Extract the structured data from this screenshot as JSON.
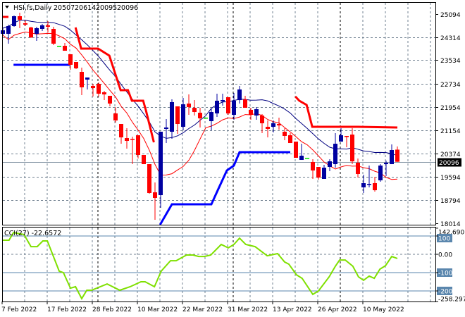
{
  "header": {
    "symbol": "HSI,fs,Daily",
    "open": "20507",
    "high": "20614",
    "low": "20095",
    "close": "20096"
  },
  "colors": {
    "bull": "#0000a0",
    "bear": "#ff0000",
    "doji": "#00e000",
    "stop_upper": "#ff0000",
    "stop_lower": "#0000ff",
    "ma_high": "#000080",
    "ma_low": "#ff0000",
    "cci": "#7fe000",
    "level": "#5a86ad",
    "grid": "#708090"
  },
  "chart_data": [
    {
      "type": "candlestick",
      "title": "HSI,fs,Daily",
      "ylim": [
        18014,
        25094
      ],
      "y_ticks": [
        "25094",
        "24314",
        "23534",
        "22734",
        "21954",
        "21154",
        "20374",
        "19594",
        "18794",
        "18014"
      ],
      "y_tick_values": [
        25094,
        24314,
        23534,
        22734,
        21954,
        21154,
        20374,
        19594,
        18794,
        18014
      ],
      "current_price": 20096,
      "current_price_label": "20096",
      "x_labels": [
        {
          "index": 0,
          "label": "7 Feb 2022"
        },
        {
          "index": 8,
          "label": "17 Feb 2022"
        },
        {
          "index": 16,
          "label": "28 Feb 2022"
        },
        {
          "index": 24,
          "label": "10 Mar 2022"
        },
        {
          "index": 32,
          "label": "22 Mar 2022"
        },
        {
          "index": 40,
          "label": "31 Mar 2022"
        },
        {
          "index": 48,
          "label": "13 Apr 2022"
        },
        {
          "index": 56,
          "label": "26 Apr 2022"
        },
        {
          "index": 64,
          "label": "10 May 2022"
        }
      ],
      "separators": [
        17,
        41,
        60
      ],
      "ohlc": [
        [
          24426,
          24617,
          24379,
          24546
        ],
        [
          24426,
          24736,
          24093,
          24689
        ],
        [
          24689,
          25046,
          24665,
          25022
        ],
        [
          25022,
          25142,
          24617,
          24903
        ],
        [
          24784,
          24879,
          24689,
          24736
        ],
        [
          24641,
          24665,
          24283,
          24307
        ],
        [
          24426,
          24665,
          24188,
          24617
        ],
        [
          24593,
          24760,
          24522,
          24713
        ],
        [
          24713,
          24856,
          24474,
          24665
        ],
        [
          24593,
          24665,
          24045,
          24093
        ],
        [
          24021,
          24021,
          24021,
          24021
        ],
        [
          24021,
          24117,
          23854,
          23854
        ],
        [
          23735,
          23735,
          23211,
          23378
        ],
        [
          23473,
          23473,
          23234,
          23258
        ],
        [
          23139,
          23282,
          22353,
          22615
        ],
        [
          22877,
          22948,
          22543,
          22948
        ],
        [
          22662,
          22734,
          22305,
          22591
        ],
        [
          22734,
          22782,
          22305,
          22400
        ],
        [
          22448,
          22496,
          22185,
          22376
        ],
        [
          22329,
          22329,
          21971,
          22066
        ],
        [
          21733,
          21947,
          21423,
          21494
        ],
        [
          21375,
          21375,
          20707,
          20922
        ],
        [
          20898,
          21232,
          20541,
          20803
        ],
        [
          20874,
          20946,
          20016,
          20850
        ],
        [
          20994,
          20994,
          20207,
          20326
        ],
        [
          20326,
          20326,
          20016,
          20016
        ],
        [
          20016,
          20016,
          19015,
          19039
        ],
        [
          19063,
          19397,
          18133,
          18872
        ],
        [
          18967,
          21113,
          18538,
          21113
        ],
        [
          21208,
          21542,
          20731,
          21256
        ],
        [
          21113,
          22209,
          20874,
          22114
        ],
        [
          21971,
          21971,
          21041,
          21375
        ],
        [
          21280,
          22257,
          21160,
          22042
        ],
        [
          22066,
          22376,
          21685,
          21947
        ],
        [
          21923,
          22185,
          21661,
          21780
        ],
        [
          21756,
          21923,
          21256,
          21566
        ],
        [
          21590,
          21590,
          21590,
          21590
        ],
        [
          21470,
          21876,
          21160,
          21780
        ],
        [
          21733,
          22400,
          21613,
          22162
        ],
        [
          22138,
          22400,
          21995,
          22185
        ],
        [
          22281,
          22281,
          21685,
          21733
        ],
        [
          21685,
          22424,
          21518,
          22162
        ],
        [
          22185,
          22662,
          22066,
          22543
        ],
        [
          22209,
          22329,
          21923,
          21923
        ],
        [
          21852,
          21923,
          21518,
          21685
        ],
        [
          21661,
          21947,
          21518,
          21876
        ],
        [
          21661,
          21709,
          21065,
          21399
        ],
        [
          21280,
          21494,
          20922,
          21208
        ],
        [
          21280,
          21494,
          21089,
          21399
        ],
        [
          21375,
          21590,
          21184,
          21327
        ],
        [
          21113,
          21232,
          20827,
          20970
        ],
        [
          20994,
          21065,
          20731,
          20731
        ],
        [
          20779,
          20779,
          20231,
          20231
        ],
        [
          20159,
          20707,
          20159,
          20302
        ],
        [
          20231,
          20231,
          20231,
          20231
        ],
        [
          20088,
          20183,
          19516,
          19802
        ],
        [
          19921,
          19921,
          19492,
          19564
        ],
        [
          19516,
          19992,
          19516,
          19897
        ],
        [
          19921,
          20183,
          19778,
          20112
        ],
        [
          20016,
          21065,
          19897,
          20707
        ],
        [
          20779,
          21232,
          20779,
          20994
        ],
        [
          20970,
          20970,
          20588,
          20946
        ],
        [
          21017,
          21232,
          20016,
          20112
        ],
        [
          20064,
          20207,
          19564,
          19683
        ],
        [
          19230,
          19659,
          19039,
          19373
        ],
        [
          19325,
          19969,
          19230,
          19349
        ],
        [
          19373,
          19587,
          19086,
          19134
        ],
        [
          19468,
          20016,
          19421,
          19969
        ],
        [
          20016,
          20135,
          19611,
          20064
        ],
        [
          20016,
          20684,
          20016,
          20493
        ],
        [
          20507,
          20614,
          20095,
          20096
        ]
      ],
      "ma_high": {
        "source": "high",
        "period": 10
      },
      "ma_low": {
        "source": "low",
        "period": 8,
        "shift": 0
      },
      "stop_upper_segments": [
        [
          [
            -0.1,
            24999
          ],
          [
            1,
            24999
          ]
        ],
        [
          [
            12.9,
            24641
          ],
          [
            13.9,
            23926
          ],
          [
            16.9,
            23926
          ],
          [
            18.9,
            23688
          ],
          [
            20.9,
            22519
          ],
          [
            22.2,
            22519
          ],
          [
            22.9,
            22162
          ],
          [
            24.9,
            22162
          ],
          [
            25.4,
            21828
          ],
          [
            26.8,
            20755
          ]
        ],
        [
          [
            51.9,
            22305
          ],
          [
            52.6,
            22162
          ],
          [
            53.9,
            22019
          ],
          [
            54.9,
            21280
          ],
          [
            62.9,
            21280
          ],
          [
            70,
            21256
          ]
        ]
      ],
      "stop_lower_segments": [
        [
          [
            1.9,
            23378
          ],
          [
            11.9,
            23378
          ]
        ],
        [
          [
            27.9,
            17942
          ],
          [
            30,
            18657
          ],
          [
            37,
            18657
          ],
          [
            38.25,
            19182
          ],
          [
            39.75,
            19801
          ],
          [
            41,
            19968
          ],
          [
            42,
            20421
          ],
          [
            51,
            20421
          ]
        ]
      ]
    },
    {
      "type": "line",
      "title": "CCI(27) -22.6572",
      "ylim": [
        -258.297,
        142.6901
      ],
      "levels": [
        100,
        -100,
        -200
      ],
      "y_ticks": [
        {
          "value": 142.6901,
          "label": "142.6901",
          "boxed": false
        },
        {
          "value": 100,
          "label": "100",
          "boxed": true
        },
        {
          "value": 0,
          "label": "0.00",
          "boxed": false
        },
        {
          "value": -100,
          "label": "-100",
          "boxed": true
        },
        {
          "value": -200,
          "label": "-200",
          "boxed": true
        },
        {
          "value": -258.297,
          "label": "-258.297",
          "boxed": false
        }
      ],
      "points": [
        [
          0,
          77
        ],
        [
          1.1,
          77
        ],
        [
          1.9,
          119
        ],
        [
          3.75,
          108
        ],
        [
          5,
          42
        ],
        [
          6.1,
          42
        ],
        [
          7.1,
          73
        ],
        [
          7.9,
          73
        ],
        [
          10,
          -92
        ],
        [
          10.75,
          -100
        ],
        [
          12,
          -185
        ],
        [
          12.9,
          -177
        ],
        [
          14,
          -242
        ],
        [
          14.9,
          -196
        ],
        [
          15.75,
          -196
        ],
        [
          18.5,
          -162
        ],
        [
          20.75,
          -196
        ],
        [
          22.6,
          -177
        ],
        [
          24.5,
          -150
        ],
        [
          25.25,
          -150
        ],
        [
          26.9,
          -177
        ],
        [
          28.1,
          -92
        ],
        [
          29.75,
          -35
        ],
        [
          30.75,
          -35
        ],
        [
          32.6,
          -4
        ],
        [
          33.75,
          -4
        ],
        [
          34.75,
          -12
        ],
        [
          35.75,
          -12
        ],
        [
          36.9,
          -4
        ],
        [
          38.75,
          54
        ],
        [
          40,
          35
        ],
        [
          41,
          54
        ],
        [
          42,
          88
        ],
        [
          43.1,
          54
        ],
        [
          44.75,
          42
        ],
        [
          46.9,
          -8
        ],
        [
          48.75,
          4
        ],
        [
          50,
          -42
        ],
        [
          50.75,
          -54
        ],
        [
          52.1,
          -112
        ],
        [
          53.1,
          -131
        ],
        [
          55,
          -219
        ],
        [
          56,
          -200
        ],
        [
          57.9,
          -123
        ],
        [
          59,
          -65
        ],
        [
          59.75,
          -31
        ],
        [
          60.75,
          -31
        ],
        [
          62.1,
          -65
        ],
        [
          63.1,
          -123
        ],
        [
          64,
          -142
        ],
        [
          65,
          -119
        ],
        [
          65.9,
          -131
        ],
        [
          66.9,
          -81
        ],
        [
          67.9,
          -62
        ],
        [
          69,
          -12
        ],
        [
          70,
          -22.6572
        ]
      ]
    }
  ]
}
